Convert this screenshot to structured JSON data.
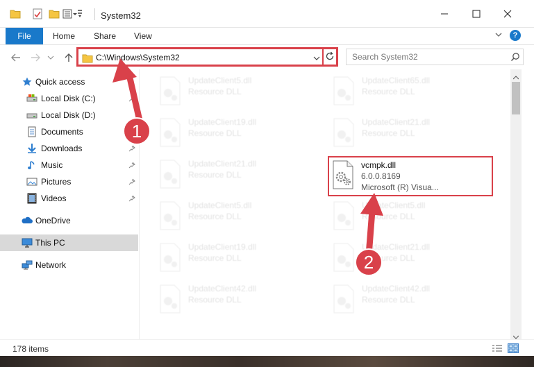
{
  "window": {
    "title": "System32"
  },
  "ribbon": {
    "tabs": [
      {
        "label": "File",
        "active": true
      },
      {
        "label": "Home"
      },
      {
        "label": "Share"
      },
      {
        "label": "View"
      }
    ],
    "help_label": "?"
  },
  "address": {
    "path": "C:\\Windows\\System32"
  },
  "search": {
    "placeholder": "Search System32"
  },
  "sidebar": {
    "items": [
      {
        "label": "Quick access",
        "icon": "star-icon"
      },
      {
        "label": "Local Disk (C:)",
        "icon": "drive-icon",
        "pinned": true
      },
      {
        "label": "Local Disk (D:)",
        "icon": "drive-icon"
      },
      {
        "label": "Documents",
        "icon": "documents-icon",
        "pinned": true
      },
      {
        "label": "Downloads",
        "icon": "downloads-icon",
        "pinned": true
      },
      {
        "label": "Music",
        "icon": "music-icon",
        "pinned": true
      },
      {
        "label": "Pictures",
        "icon": "pictures-icon",
        "pinned": true
      },
      {
        "label": "Videos",
        "icon": "videos-icon",
        "pinned": true
      },
      {
        "label": "OneDrive",
        "icon": "onedrive-icon"
      },
      {
        "label": "This PC",
        "icon": "pc-icon",
        "selected": true
      },
      {
        "label": "Network",
        "icon": "network-icon"
      }
    ]
  },
  "files": [
    {
      "name": "UpdateClient5.dll",
      "desc": "Resource DLL"
    },
    {
      "name": "UpdateClient65.dll",
      "desc": "Resource DLL"
    },
    {
      "name": "UpdateClient19.dll",
      "desc": "Resource DLL"
    },
    {
      "name": "UpdateClient21.dll",
      "desc": "Resource DLL"
    },
    {
      "name": "UpdateClient21.dll",
      "desc": "Resource DLL"
    },
    {
      "name": "vcmpk.dll",
      "version": "6.0.0.8169",
      "company": "Microsoft (R) Visua...",
      "highlighted": true
    },
    {
      "name": "UpdateClient5.dll",
      "desc": "Resource DLL"
    },
    {
      "name": "UpdateClient5.dll",
      "desc": "Resource DLL"
    },
    {
      "name": "UpdateClient19.dll",
      "desc": "Resource DLL"
    },
    {
      "name": "UpdateClient21.dll",
      "desc": "Resource DLL"
    },
    {
      "name": "UpdateClient42.dll",
      "desc": "Resource DLL"
    },
    {
      "name": "UpdateClient42.dll",
      "desc": "Resource DLL"
    }
  ],
  "status": {
    "item_count": "178 items"
  },
  "annotations": {
    "step1": "1",
    "step2": "2",
    "color": "#d9414a"
  }
}
